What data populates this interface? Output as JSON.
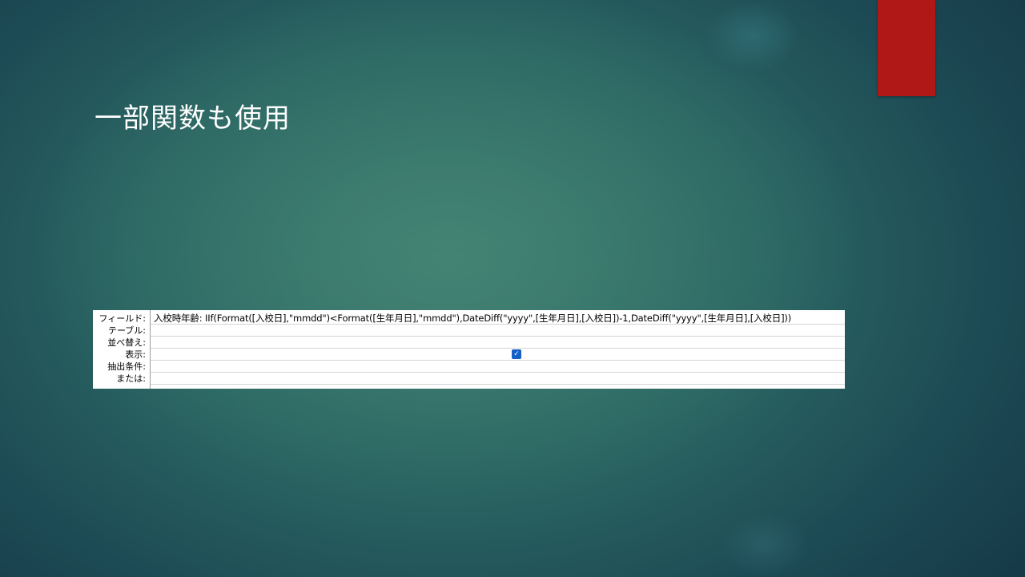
{
  "slide": {
    "title": "一部関数も使用"
  },
  "colors": {
    "accent_bar": "#b01717",
    "background": "#2a6462",
    "checkbox": "#1560c7"
  },
  "query_design_grid": {
    "row_labels": {
      "field": "フィールド:",
      "table": "テーブル:",
      "sort": "並べ替え:",
      "show": "表示:",
      "criteria": "抽出条件:",
      "or": "または:"
    },
    "column": {
      "field": "入校時年齢: IIf(Format([入校日],\"mmdd\")<Format([生年月日],\"mmdd\"),DateDiff(\"yyyy\",[生年月日],[入校日])-1,DateDiff(\"yyyy\",[生年月日],[入校日]))",
      "table": "",
      "sort": "",
      "show_checked": true,
      "criteria": "",
      "or": ""
    }
  }
}
